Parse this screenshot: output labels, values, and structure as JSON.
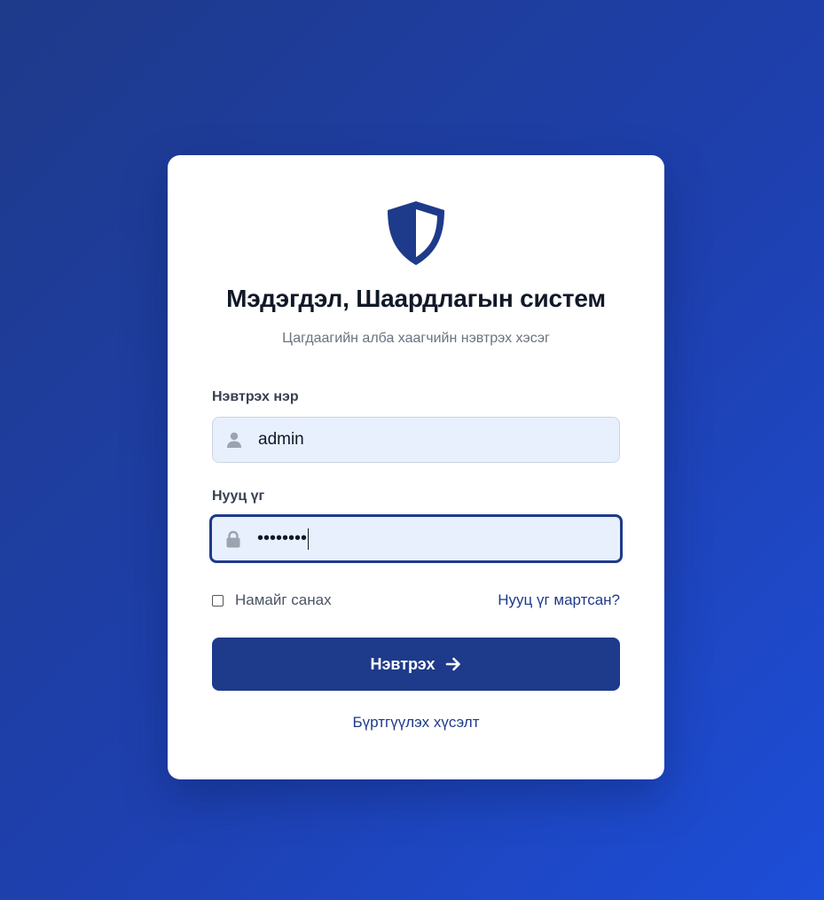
{
  "header": {
    "title": "Мэдэгдэл, Шаардлагын систем",
    "subtitle": "Цагдаагийн алба хаагчийн нэвтрэх хэсэг",
    "logo_icon": "shield-icon"
  },
  "form": {
    "username": {
      "label": "Нэвтрэх нэр",
      "value": "admin",
      "icon": "user-icon"
    },
    "password": {
      "label": "Нууц үг",
      "masked_value": "••••••••",
      "icon": "lock-icon"
    },
    "remember_me_label": "Намайг санах",
    "remember_me_checked": false,
    "forgot_password_link": "Нууц үг мартсан?",
    "submit_label": "Нэвтрэх",
    "submit_icon": "arrow-right-icon",
    "register_link": "Бүртгүүлэх хүсэлт"
  },
  "colors": {
    "primary": "#1e3a8a",
    "background_gradient_start": "#1e3a8a",
    "background_gradient_end": "#1d4ed8",
    "input_background": "#e8f0fe"
  }
}
